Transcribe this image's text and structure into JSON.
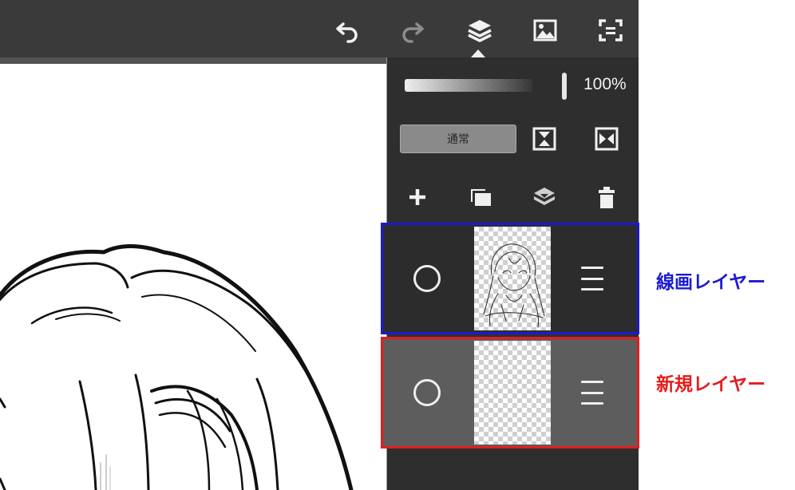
{
  "toolbar": {
    "icons": [
      "undo-icon",
      "redo-icon",
      "layers-icon",
      "image-icon",
      "fullscreen-icon"
    ]
  },
  "layer_panel": {
    "opacity_value": "100%",
    "blend_mode": "通常",
    "action_icons": [
      "plus-icon",
      "duplicate-layer-icon",
      "merge-down-icon",
      "trash-icon"
    ],
    "layers": [
      {
        "visibility_icon": "circle-icon",
        "menu_icon": "hamburger-icon",
        "highlight_color": "#1a1ad2"
      },
      {
        "visibility_icon": "circle-icon",
        "menu_icon": "hamburger-icon",
        "highlight_color": "#e51c1c"
      }
    ]
  },
  "annotations": {
    "line_layer": "線画レイヤー",
    "line_layer_color": "#1a1ad2",
    "new_layer": "新規レイヤー",
    "new_layer_color": "#e51c1c"
  }
}
